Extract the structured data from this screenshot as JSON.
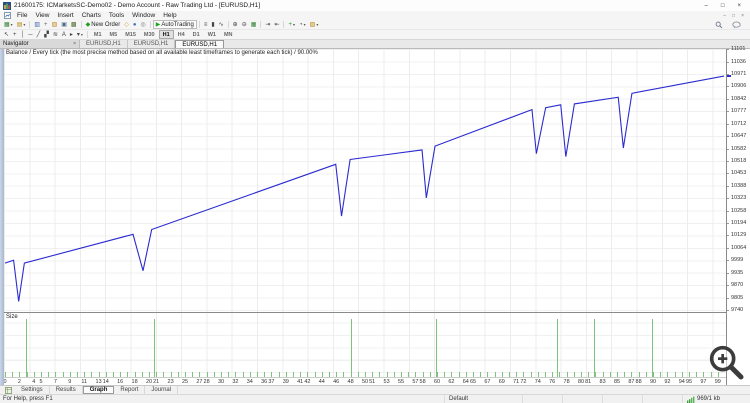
{
  "titlebar": {
    "title": "21600175: ICMarketsSC-Demo02 - Demo Account - Raw Trading Ltd - [EURUSD,H1]",
    "minimize": "–",
    "maximize": "□",
    "close": "×"
  },
  "menubar": {
    "items": [
      "File",
      "View",
      "Insert",
      "Charts",
      "Tools",
      "Window",
      "Help"
    ],
    "child_minimize": "–",
    "child_restore": "□",
    "child_close": "×"
  },
  "toolbar_main": {
    "groups": [
      [
        {
          "name": "new-chart",
          "glyph": "▦",
          "color": "#2e7d32",
          "dropdown": true
        },
        {
          "name": "profiles",
          "glyph": "▤",
          "color": "#b8860b",
          "dropdown": true
        }
      ],
      [
        {
          "name": "market-watch",
          "glyph": "▥",
          "color": "#4466aa"
        },
        {
          "name": "data-window",
          "glyph": "+",
          "color": "#666666"
        },
        {
          "name": "navigator-panel",
          "glyph": "▧",
          "color": "#c08a2a"
        },
        {
          "name": "terminal-panel",
          "glyph": "▣",
          "color": "#4a6b8a"
        },
        {
          "name": "strategy-tester",
          "glyph": "▩",
          "color": "#556b2f"
        }
      ],
      [
        {
          "name": "new-order",
          "glyph": "◆",
          "color": "#1e9e1e",
          "label": "New Order"
        },
        {
          "name": "metaeditor",
          "glyph": "◇",
          "color": "#caa53a"
        },
        {
          "name": "mql5-community",
          "glyph": "●",
          "color": "#3b6fb5"
        },
        {
          "name": "web-terminal",
          "glyph": "◎",
          "color": "#777777"
        }
      ],
      [
        {
          "name": "autotrading",
          "glyph": "▶",
          "color": "#1ca81c",
          "label": "AutoTrading",
          "framed": true
        }
      ],
      [
        {
          "name": "bar-chart-mode",
          "glyph": "≡",
          "color": "#444444"
        },
        {
          "name": "candlestick-mode",
          "glyph": "▮",
          "color": "#444444"
        },
        {
          "name": "line-chart-mode",
          "glyph": "∿",
          "color": "#444444"
        }
      ],
      [
        {
          "name": "zoom-in",
          "glyph": "⊕",
          "color": "#444444"
        },
        {
          "name": "zoom-out",
          "glyph": "⊖",
          "color": "#444444"
        },
        {
          "name": "tile-windows",
          "glyph": "▦",
          "color": "#2e7d32"
        }
      ],
      [
        {
          "name": "auto-scroll",
          "glyph": "⇥",
          "color": "#444444"
        },
        {
          "name": "chart-shift",
          "glyph": "⇤",
          "color": "#444444"
        }
      ],
      [
        {
          "name": "indicators",
          "glyph": "+",
          "color": "#1e9e1e",
          "dropdown": true
        },
        {
          "name": "periods",
          "glyph": "◔",
          "color": "#444444",
          "dropdown": true
        },
        {
          "name": "templates",
          "glyph": "▨",
          "color": "#b8860b",
          "dropdown": true
        }
      ]
    ]
  },
  "toolbar_draw": {
    "tools": [
      {
        "name": "cursor",
        "glyph": "↖"
      },
      {
        "name": "crosshair",
        "glyph": "+"
      },
      {
        "name": "vertical-line",
        "glyph": "│"
      },
      {
        "name": "horizontal-line",
        "glyph": "─"
      },
      {
        "name": "trendline",
        "glyph": "╱"
      },
      {
        "name": "equidistant-channel",
        "glyph": "▞"
      },
      {
        "name": "fibonacci",
        "glyph": "≋"
      },
      {
        "name": "text-label",
        "glyph": "A"
      },
      {
        "name": "arrow-label",
        "glyph": "▸"
      },
      {
        "name": "shapes",
        "glyph": "▾",
        "dropdown": true
      }
    ],
    "timeframes": [
      "M1",
      "M5",
      "M15",
      "M30",
      "H1",
      "H4",
      "D1",
      "W1",
      "MN"
    ],
    "active_timeframe": "H1"
  },
  "navigator": {
    "title": "Navigator",
    "close": "×"
  },
  "chart_tabs": [
    {
      "label": "EURUSD,H1",
      "active": false
    },
    {
      "label": "EURUSD,H1",
      "active": false
    },
    {
      "label": "EURUSD,H1",
      "active": true
    }
  ],
  "tester": {
    "caption": "Balance / Every tick (the most precise method based on all available least timeframes to generate each tick) / 90.00%",
    "size_label": "Size",
    "bottom_tabs": [
      {
        "label": "Settings",
        "active": false
      },
      {
        "label": "Results",
        "active": false
      },
      {
        "label": "Graph",
        "active": true
      },
      {
        "label": "Report",
        "active": false
      },
      {
        "label": "Journal",
        "active": false
      }
    ]
  },
  "statusbar": {
    "help_text": "For Help, press F1",
    "template_name": "Default",
    "connection": "969/1 kb"
  },
  "chart_data": {
    "type": "line",
    "title": "Balance",
    "caption": "Balance / Every tick (the most precise method based on all available least timeframes to generate each tick) / 90.00%",
    "modelling_quality_pct": 90.0,
    "line_color": "#2b2bd0",
    "grid": true,
    "xlim": [
      0,
      100.28
    ],
    "ylim": [
      9740,
      11101
    ],
    "x_ticks": [
      0,
      2,
      4,
      5,
      7,
      9,
      11,
      13,
      14,
      16,
      18,
      20,
      21,
      23,
      25,
      27,
      28,
      30,
      32,
      34,
      36,
      37,
      39,
      41,
      42,
      44,
      46,
      48,
      50,
      51,
      53,
      55,
      57,
      58,
      60,
      62,
      64,
      65,
      67,
      69,
      71,
      72,
      74,
      76,
      78,
      80,
      81,
      83,
      85,
      87,
      88,
      90,
      92,
      94,
      95,
      97,
      99
    ],
    "y_ticks": [
      11101,
      11036,
      10971,
      10906,
      10842,
      10777,
      10712,
      10647,
      10582,
      10518,
      10453,
      10388,
      10323,
      10258,
      10194,
      10129,
      10064,
      9999,
      9935,
      9870,
      9805,
      9740
    ],
    "series": [
      {
        "name": "Balance",
        "points": [
          [
            0,
            9990
          ],
          [
            1.2,
            10005
          ],
          [
            1.9,
            9790
          ],
          [
            2.7,
            9990
          ],
          [
            17.8,
            10140
          ],
          [
            19.2,
            9950
          ],
          [
            20.4,
            10165
          ],
          [
            46,
            10505
          ],
          [
            46.8,
            10235
          ],
          [
            48,
            10530
          ],
          [
            58,
            10580
          ],
          [
            58.6,
            10330
          ],
          [
            59.8,
            10600
          ],
          [
            73.3,
            10790
          ],
          [
            73.9,
            10560
          ],
          [
            75.2,
            10800
          ],
          [
            77.3,
            10815
          ],
          [
            78,
            10545
          ],
          [
            79.2,
            10820
          ],
          [
            85.3,
            10855
          ],
          [
            86,
            10590
          ],
          [
            87.2,
            10875
          ],
          [
            100,
            10965
          ]
        ]
      }
    ],
    "size_panel": {
      "label": "Size",
      "bar_color": "#7cc47c",
      "trades_count": 100,
      "small_bars_every_trade": true,
      "large_bar_trades": [
        2.9,
        20.7,
        48,
        59.9,
        76.6,
        81.8,
        89.8
      ]
    }
  }
}
